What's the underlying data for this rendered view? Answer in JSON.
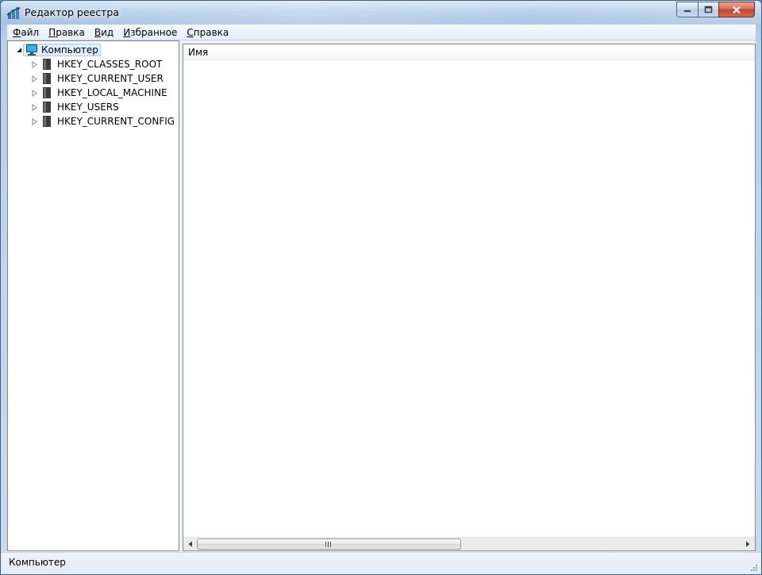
{
  "window": {
    "title": "Редактор реестра"
  },
  "menu": {
    "items": [
      {
        "accel": "Ф",
        "rest": "айл"
      },
      {
        "accel": "П",
        "rest": "равка"
      },
      {
        "accel": "В",
        "rest": "ид"
      },
      {
        "accel": "И",
        "rest": "збранное"
      },
      {
        "accel": "С",
        "rest": "правка"
      }
    ]
  },
  "tree": {
    "root": {
      "label": "Компьютер",
      "icon": "computer-icon",
      "expanded": true
    },
    "hives": [
      {
        "label": "HKEY_CLASSES_ROOT",
        "icon": "folder-icon"
      },
      {
        "label": "HKEY_CURRENT_USER",
        "icon": "folder-icon"
      },
      {
        "label": "HKEY_LOCAL_MACHINE",
        "icon": "folder-icon"
      },
      {
        "label": "HKEY_USERS",
        "icon": "folder-icon"
      },
      {
        "label": "HKEY_CURRENT_CONFIG",
        "icon": "folder-icon"
      }
    ]
  },
  "list": {
    "columns": [
      {
        "label": "Имя"
      }
    ]
  },
  "status": {
    "path": "Компьютер"
  },
  "colors": {
    "selection": "#ddeefc",
    "titlebar": "#b4cde8",
    "close_button": "#c0452b"
  }
}
